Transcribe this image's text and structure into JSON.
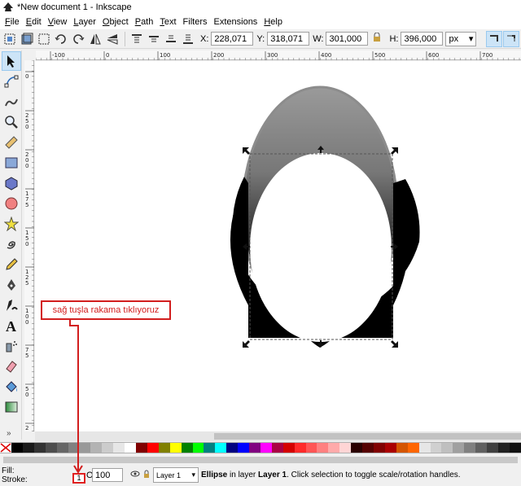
{
  "window": {
    "title": "*New document 1 - Inkscape"
  },
  "menubar": {
    "items": [
      {
        "label": "File",
        "accel": "F",
        "rest": "ile"
      },
      {
        "label": "Edit",
        "accel": "E",
        "rest": "dit"
      },
      {
        "label": "View",
        "accel": "V",
        "rest": "iew"
      },
      {
        "label": "Layer",
        "accel": "L",
        "rest": "ayer"
      },
      {
        "label": "Object",
        "accel": "O",
        "rest": "bject"
      },
      {
        "label": "Path",
        "accel": "P",
        "rest": "ath"
      },
      {
        "label": "Text",
        "accel": "T",
        "rest": "ext"
      },
      {
        "label": "Filters",
        "accel": "",
        "rest": "Filters"
      },
      {
        "label": "Extensions",
        "accel": "",
        "rest": "Extensions"
      },
      {
        "label": "Help",
        "accel": "H",
        "rest": "elp"
      }
    ]
  },
  "controls": {
    "x_label": "X:",
    "x_value": "228,071",
    "y_label": "Y:",
    "y_value": "318,071",
    "w_label": "W:",
    "w_value": "301,000",
    "h_label": "H:",
    "h_value": "396,000",
    "unit": "px"
  },
  "rulers": {
    "h_ticks": [
      "-100",
      "0",
      "100",
      "200",
      "300",
      "400",
      "500",
      "600",
      "700"
    ],
    "v_ticks": [
      "0",
      "2 5 0",
      "2 0 0",
      "1 7 5",
      "1 5 0",
      "1 2 5",
      "1 0 0",
      "7 5",
      "5 0",
      "2 5"
    ]
  },
  "canvas": {
    "shape_fill_top": "#8a8a8a",
    "shape_fill_dark": "#000000",
    "selection_color": "#555555"
  },
  "palette": {
    "colors": [
      "#000000",
      "#1a1a1a",
      "#333333",
      "#4d4d4d",
      "#666666",
      "#808080",
      "#999999",
      "#b3b3b3",
      "#cccccc",
      "#e6e6e6",
      "#ffffff",
      "#800000",
      "#ff0000",
      "#808000",
      "#ffff00",
      "#008000",
      "#00ff00",
      "#008080",
      "#00ffff",
      "#000080",
      "#0000ff",
      "#800080",
      "#ff00ff",
      "#aa0044",
      "#d40000",
      "#ff2a2a",
      "#ff5555",
      "#ff8080",
      "#ffaaaa",
      "#ffd5d5",
      "#2b0000",
      "#550000",
      "#800000",
      "#aa0000",
      "#d45500",
      "#ff6600",
      "#e6e6e6",
      "#d0d0d0",
      "#bfbfbf",
      "#a0a0a0",
      "#808080",
      "#606060",
      "#404040",
      "#202020",
      "#101010"
    ]
  },
  "status": {
    "fill_label": "Fill:",
    "stroke_label": "Stroke:",
    "stroke_width": "1",
    "opacity_label": "O:",
    "opacity_value": "100",
    "layer_name": "Layer 1",
    "message_object": "Ellipse",
    "message_mid": " in layer ",
    "message_layer": "Layer 1",
    "message_tail": ". Click selection to toggle scale/rotation handles."
  },
  "annotation": {
    "text": "sağ tuşla rakama tıklıyoruz",
    "color": "#d21e1e"
  },
  "toolbox": {
    "more_label": "»"
  }
}
